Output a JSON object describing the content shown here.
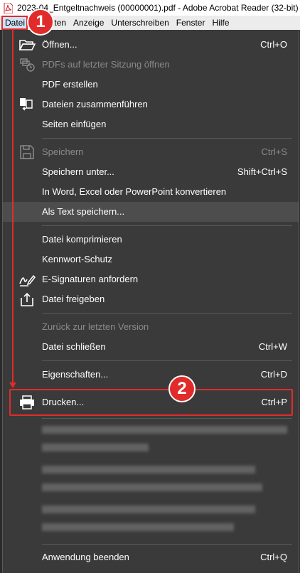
{
  "window": {
    "title": "2023-04_Entgeltnachweis (00000001).pdf - Adobe Acrobat Reader (32-bit)"
  },
  "menubar": {
    "items": [
      "Datei",
      "Bearbeiten",
      "Anzeige",
      "Unterschreiben",
      "Fenster",
      "Hilfe"
    ],
    "visible_partial_second": "eiten"
  },
  "annotations": {
    "badge1": "1",
    "badge2": "2",
    "color": "#e12b2b"
  },
  "menu": {
    "items": [
      {
        "label": "Öffnen...",
        "shortcut": "Ctrl+O",
        "icon": "folder-open-icon",
        "disabled": false
      },
      {
        "label": "PDFs auf letzter Sitzung öffnen",
        "shortcut": "",
        "icon": "restore-session-icon",
        "disabled": true
      },
      {
        "label": "PDF erstellen",
        "shortcut": "",
        "icon": "",
        "disabled": false
      },
      {
        "label": "Dateien zusammenführen",
        "shortcut": "",
        "icon": "combine-files-icon",
        "disabled": false
      },
      {
        "label": "Seiten einfügen",
        "shortcut": "",
        "icon": "",
        "disabled": false
      },
      {
        "label": "Speichern",
        "shortcut": "Ctrl+S",
        "icon": "save-icon",
        "disabled": true
      },
      {
        "label": "Speichern unter...",
        "shortcut": "Shift+Ctrl+S",
        "icon": "",
        "disabled": false
      },
      {
        "label": "In Word, Excel oder PowerPoint konvertieren",
        "shortcut": "",
        "icon": "",
        "disabled": false
      },
      {
        "label": "Als Text speichern...",
        "shortcut": "",
        "icon": "",
        "disabled": false,
        "highlight": true
      },
      {
        "label": "Datei komprimieren",
        "shortcut": "",
        "icon": "",
        "disabled": false
      },
      {
        "label": "Kennwort-Schutz",
        "shortcut": "",
        "icon": "",
        "disabled": false
      },
      {
        "label": "E-Signaturen anfordern",
        "shortcut": "",
        "icon": "signature-icon",
        "disabled": false
      },
      {
        "label": "Datei freigeben",
        "shortcut": "",
        "icon": "share-icon",
        "disabled": false
      },
      {
        "label": "Zurück zur letzten Version",
        "shortcut": "",
        "icon": "",
        "disabled": true
      },
      {
        "label": "Datei schließen",
        "shortcut": "Ctrl+W",
        "icon": "",
        "disabled": false
      },
      {
        "label": "Eigenschaften...",
        "shortcut": "Ctrl+D",
        "icon": "",
        "disabled": false
      },
      {
        "label": "Drucken...",
        "shortcut": "Ctrl+P",
        "icon": "printer-icon",
        "disabled": false
      },
      {
        "label": "Anwendung beenden",
        "shortcut": "Ctrl+Q",
        "icon": "",
        "disabled": false
      }
    ]
  }
}
